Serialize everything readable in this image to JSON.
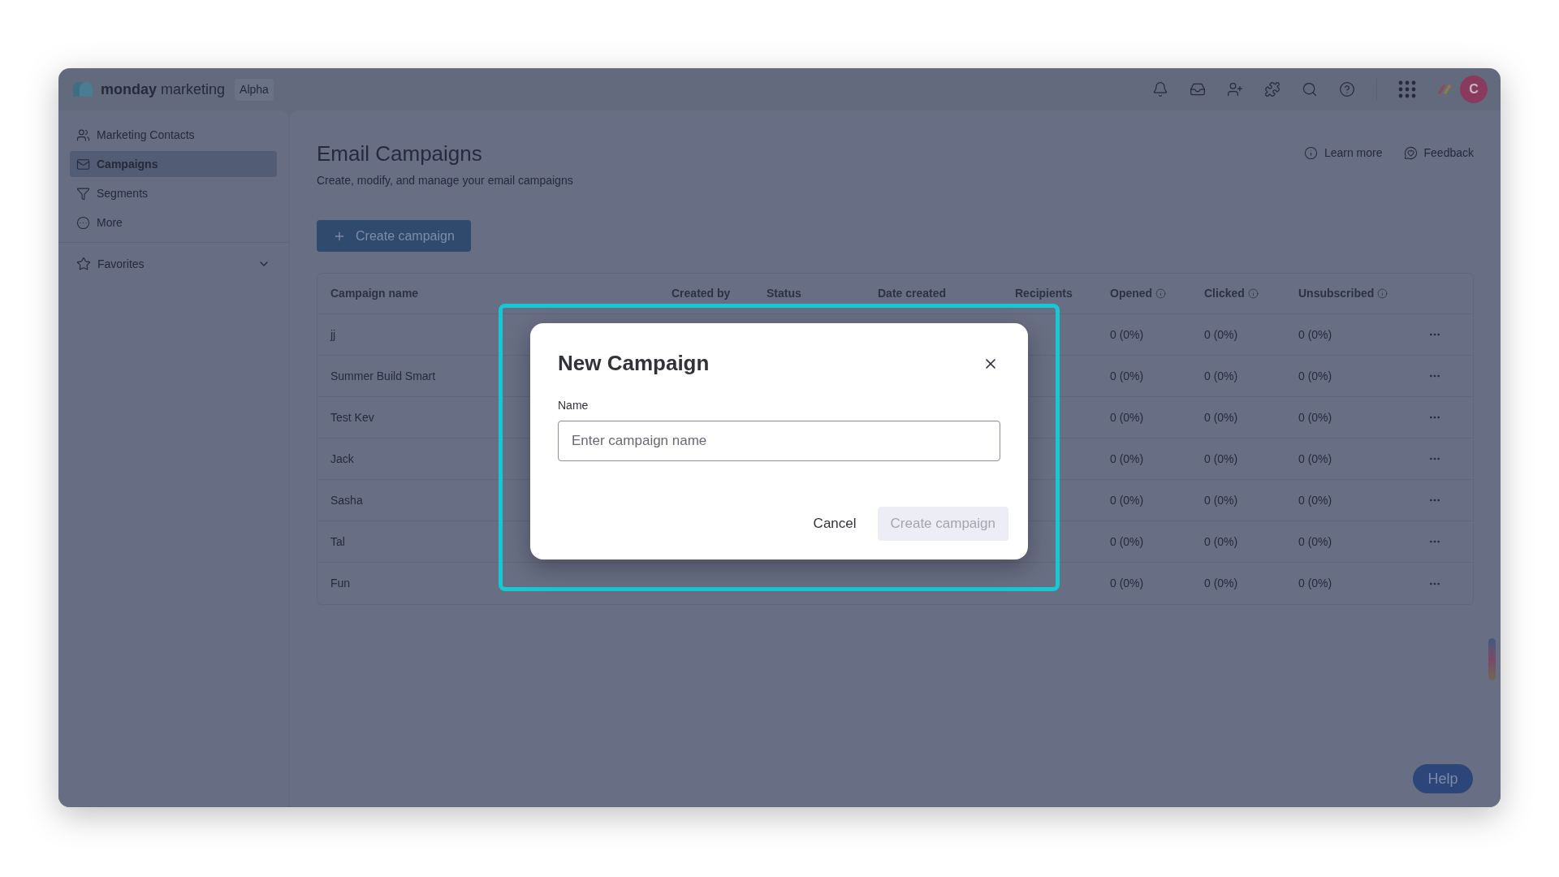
{
  "brand": {
    "name_bold": "monday",
    "name_rest": "marketing",
    "badge": "Alpha"
  },
  "avatar": {
    "initial": "C"
  },
  "sidebar": {
    "items": [
      {
        "label": "Marketing Contacts",
        "selected": false
      },
      {
        "label": "Campaigns",
        "selected": true
      },
      {
        "label": "Segments",
        "selected": false
      },
      {
        "label": "More",
        "selected": false
      }
    ],
    "favorites": {
      "label": "Favorites",
      "expanded": false
    }
  },
  "page": {
    "title": "Email Campaigns",
    "subtitle": "Create, modify, and manage your email campaigns",
    "links": [
      {
        "label": "Learn more"
      },
      {
        "label": "Feedback"
      }
    ],
    "create_button": "Create campaign"
  },
  "table": {
    "columns": [
      {
        "label": "Campaign name",
        "info": false
      },
      {
        "label": "Created by",
        "info": false
      },
      {
        "label": "Status",
        "info": false
      },
      {
        "label": "Date created",
        "info": false
      },
      {
        "label": "Recipients",
        "info": false
      },
      {
        "label": "Opened",
        "info": true
      },
      {
        "label": "Clicked",
        "info": true
      },
      {
        "label": "Unsubscribed",
        "info": true
      }
    ],
    "rows": [
      {
        "name": "jj",
        "opened": "0 (0%)",
        "clicked": "0 (0%)",
        "unsubscribed": "0 (0%)"
      },
      {
        "name": "Summer Build Smart",
        "opened": "0 (0%)",
        "clicked": "0 (0%)",
        "unsubscribed": "0 (0%)"
      },
      {
        "name": "Test Kev",
        "opened": "0 (0%)",
        "clicked": "0 (0%)",
        "unsubscribed": "0 (0%)"
      },
      {
        "name": "Jack",
        "opened": "0 (0%)",
        "clicked": "0 (0%)",
        "unsubscribed": "0 (0%)"
      },
      {
        "name": "Sasha",
        "opened": "0 (0%)",
        "clicked": "0 (0%)",
        "unsubscribed": "0 (0%)"
      },
      {
        "name": "Tal",
        "opened": "0 (0%)",
        "clicked": "0 (0%)",
        "unsubscribed": "0 (0%)"
      },
      {
        "name": "Fun",
        "opened": "0 (0%)",
        "clicked": "0 (0%)",
        "unsubscribed": "0 (0%)"
      }
    ]
  },
  "help_button": "Help",
  "dialog": {
    "title": "New Campaign",
    "field_label": "Name",
    "placeholder": "Enter campaign name",
    "cancel": "Cancel",
    "submit": {
      "label": "Create campaign",
      "disabled": true
    }
  }
}
